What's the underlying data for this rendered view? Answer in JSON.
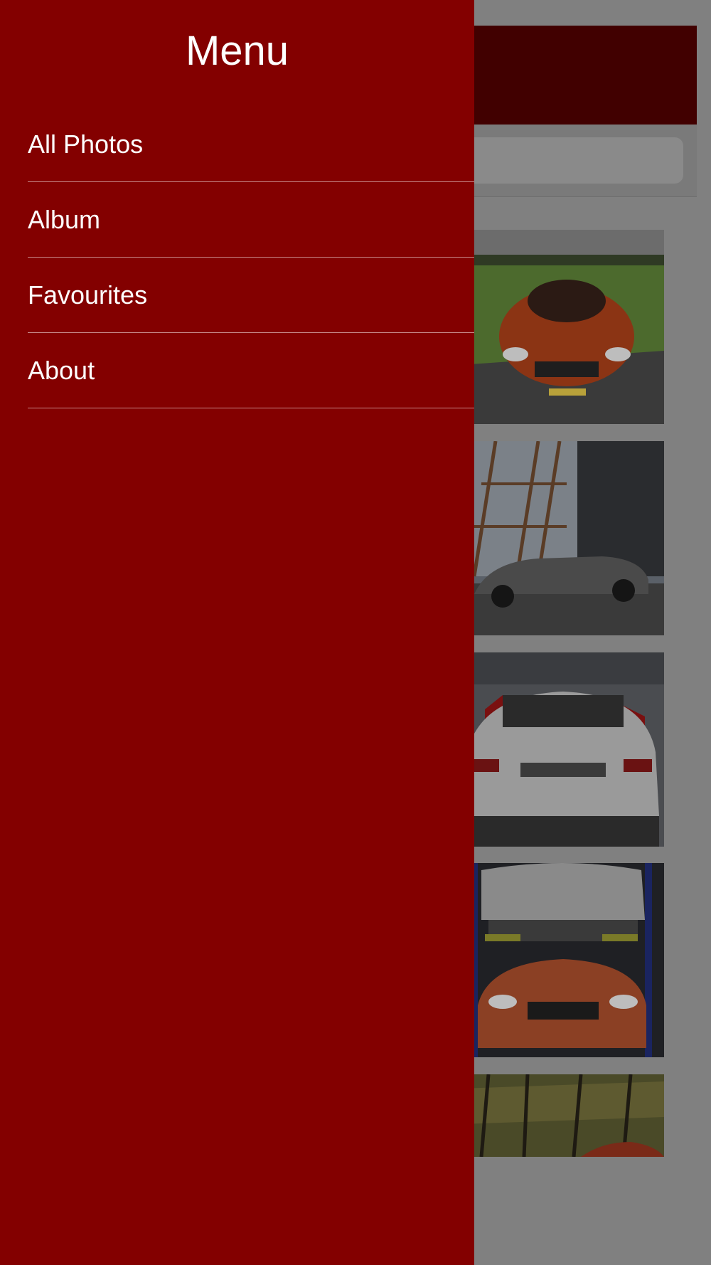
{
  "drawer": {
    "title": "Menu",
    "items": [
      {
        "label": "All Photos"
      },
      {
        "label": "Album"
      },
      {
        "label": "Favourites"
      },
      {
        "label": "About"
      }
    ]
  },
  "colors": {
    "drawer_bg": "#830000",
    "header_bg": "#410000",
    "overlay_bg": "#808080",
    "divider": "#c88a8a"
  },
  "photos": [
    {
      "subject": "orange BMW 1M front view on grass field"
    },
    {
      "subject": "grey BMW 1 series coupe side view under steel tower"
    },
    {
      "subject": "white BMW coupe rear view at auto show"
    },
    {
      "subject": "white and orange BMW cars on lift in garage"
    },
    {
      "subject": "orange BMW in forest"
    }
  ]
}
